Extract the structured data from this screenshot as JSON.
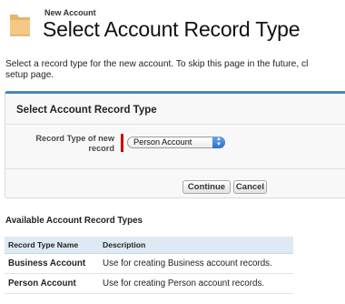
{
  "header": {
    "subtitle": "New Account",
    "title": "Select Account Record Type"
  },
  "intro": {
    "line1": "Select a record type for the new account. To skip this page in the future, cl",
    "line2": "setup page."
  },
  "form": {
    "section_title": "Select Account Record Type",
    "field_label": "Record Type of new record",
    "selected_value": "Person Account",
    "continue_label": "Continue",
    "cancel_label": "Cancel"
  },
  "available": {
    "title": "Available Account Record Types",
    "columns": [
      "Record Type Name",
      "Description"
    ],
    "rows": [
      {
        "name": "Business Account",
        "description": "Use for creating Business account records."
      },
      {
        "name": "Person Account",
        "description": "Use for creating Person account records."
      }
    ]
  },
  "colors": {
    "accent": "#4b87b8",
    "required": "#cc0000",
    "table_header": "#ddeaf4"
  },
  "icons": {
    "header": "folder-icon",
    "select": "updown-arrows-icon"
  }
}
